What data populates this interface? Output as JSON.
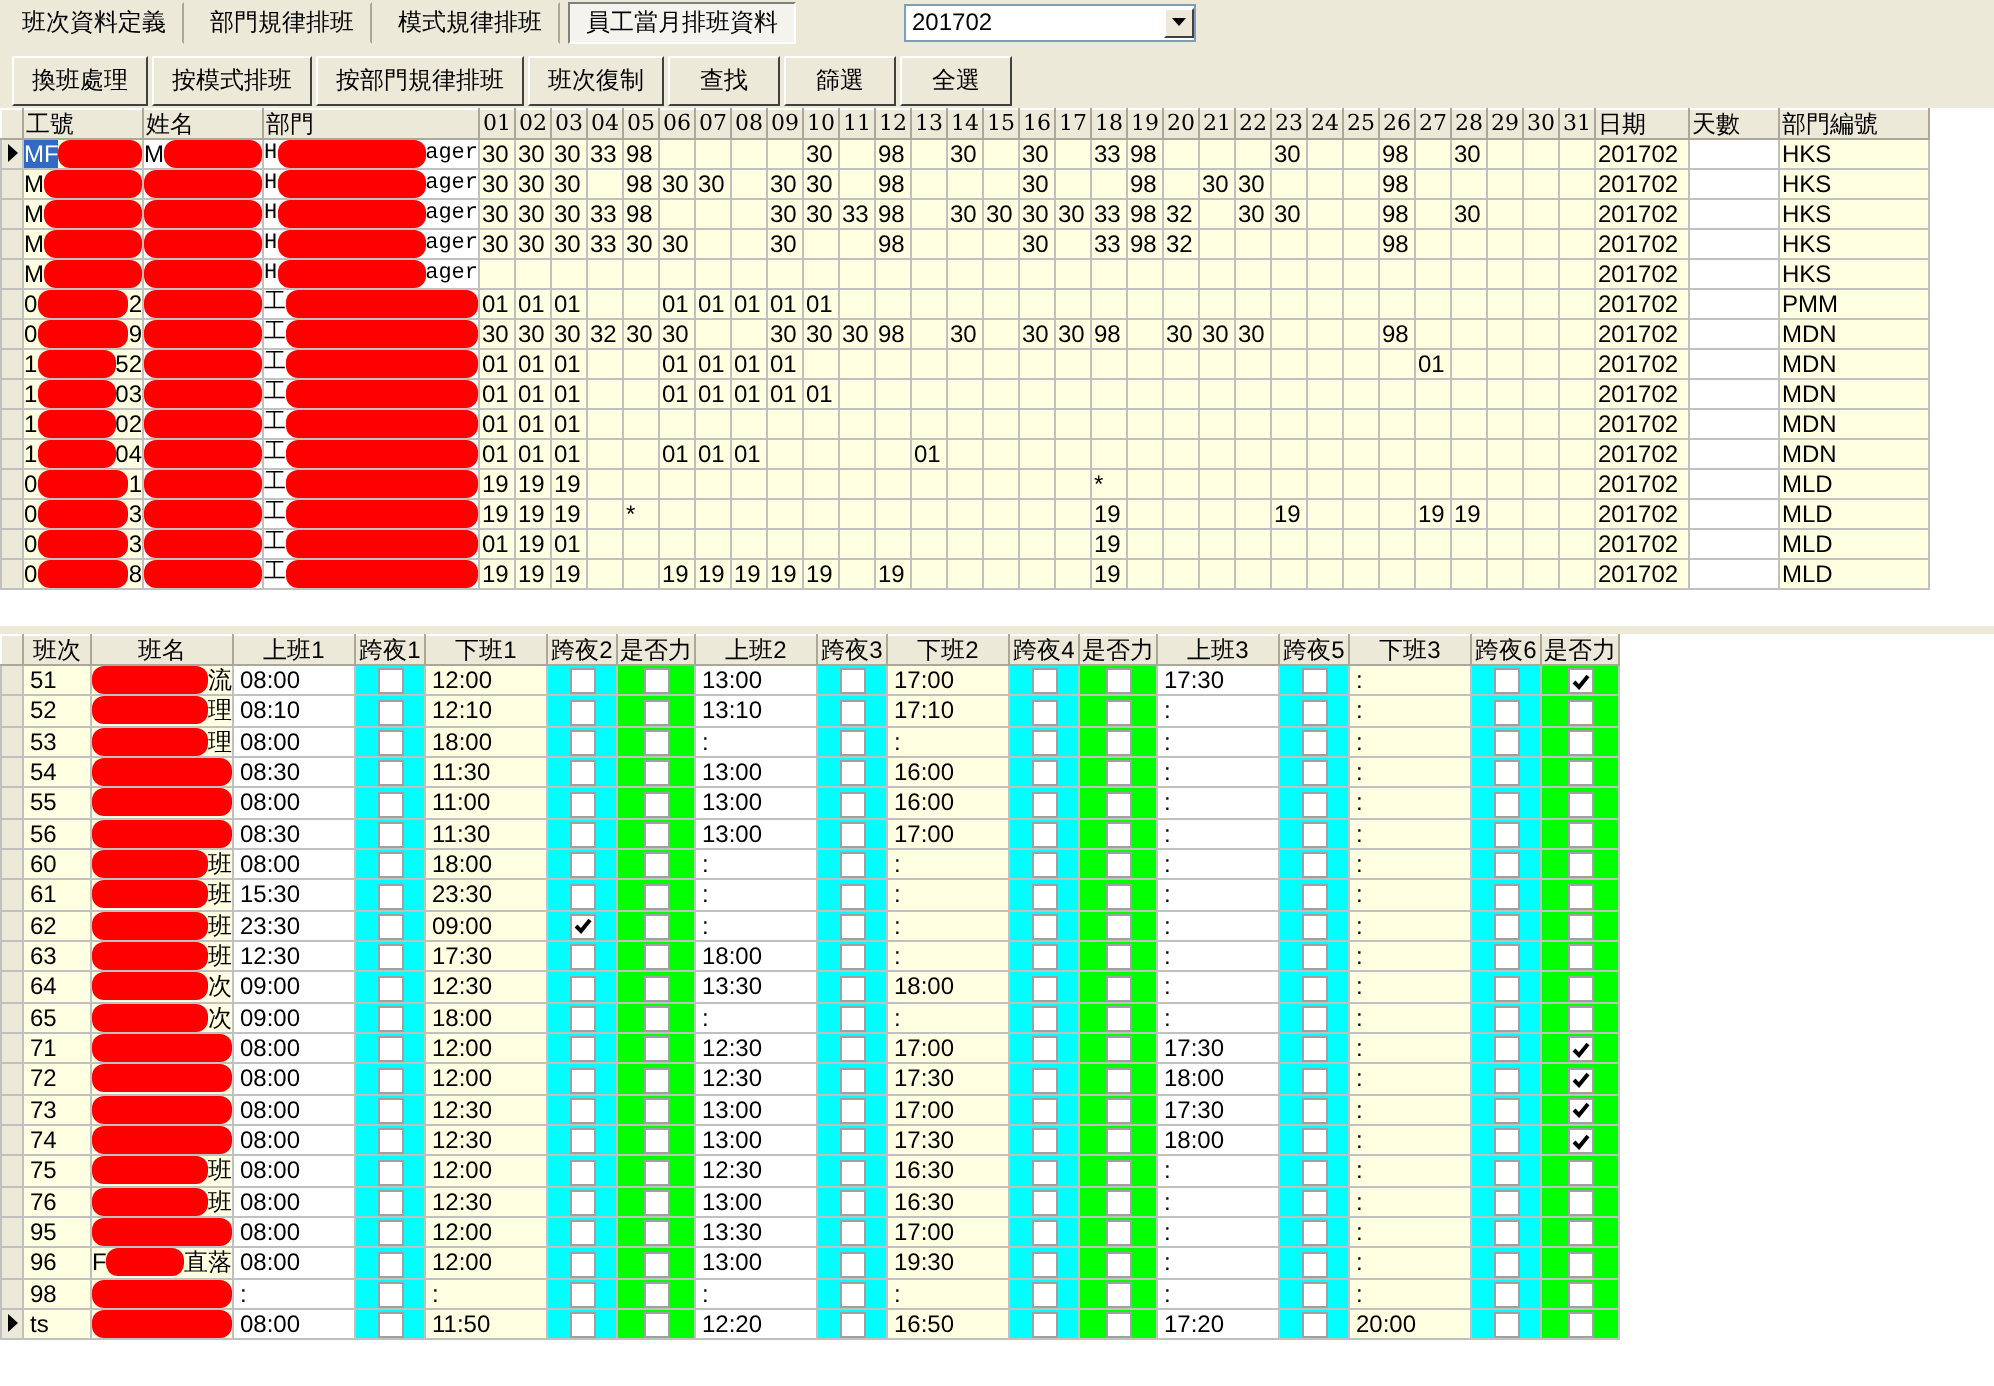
{
  "tabs": [
    {
      "label": "班次資料定義",
      "selected": false
    },
    {
      "label": "部門規律排班",
      "selected": false
    },
    {
      "label": "模式規律排班",
      "selected": false
    },
    {
      "label": "員工當月排班資料",
      "selected": true
    }
  ],
  "month_select": {
    "value": "201702"
  },
  "toolbar": [
    "換班處理",
    "按模式排班",
    "按部門規律排班",
    "班次復制",
    "查找",
    "篩選",
    "全選"
  ],
  "schedule_grid": {
    "columns": [
      "工號",
      "姓名",
      "部門"
    ],
    "day_columns": [
      "01",
      "02",
      "03",
      "04",
      "05",
      "06",
      "07",
      "08",
      "09",
      "10",
      "11",
      "12",
      "13",
      "14",
      "15",
      "16",
      "17",
      "18",
      "19",
      "20",
      "21",
      "22",
      "23",
      "24",
      "25",
      "26",
      "27",
      "28",
      "29",
      "30",
      "31"
    ],
    "tail_columns": [
      "日期",
      "天數",
      "部門編號"
    ],
    "rows": [
      {
        "current": true,
        "selected": true,
        "id": {
          "head": "MF"
        },
        "name": {
          "head": "M"
        },
        "dept": {
          "head": "H",
          "tail": "ager"
        },
        "days": {
          "d01": "30",
          "d02": "30",
          "d03": "30",
          "d04": "33",
          "d05": "98",
          "d10": "30",
          "d12": "98",
          "d14": "30",
          "d16": "30",
          "d18": "33",
          "d19": "98",
          "d23": "30",
          "d26": "98",
          "d28": "30"
        },
        "date": "201702",
        "dept_code": "HKS"
      },
      {
        "current": false,
        "selected": false,
        "id": {
          "head": "M"
        },
        "name": {},
        "dept": {
          "head": "H",
          "tail": "ager"
        },
        "days": {
          "d01": "30",
          "d02": "30",
          "d03": "30",
          "d05": "98",
          "d06": "30",
          "d07": "30",
          "d09": "30",
          "d10": "30",
          "d12": "98",
          "d16": "30",
          "d19": "98",
          "d21": "30",
          "d22": "30",
          "d26": "98"
        },
        "date": "201702",
        "dept_code": "HKS"
      },
      {
        "current": false,
        "selected": false,
        "id": {
          "head": "M"
        },
        "name": {},
        "dept": {
          "head": "H",
          "tail": "ager"
        },
        "days": {
          "d01": "30",
          "d02": "30",
          "d03": "30",
          "d04": "33",
          "d05": "98",
          "d09": "30",
          "d10": "30",
          "d11": "33",
          "d12": "98",
          "d14": "30",
          "d15": "30",
          "d16": "30",
          "d17": "30",
          "d18": "33",
          "d19": "98",
          "d20": "32",
          "d22": "30",
          "d23": "30",
          "d26": "98",
          "d28": "30"
        },
        "date": "201702",
        "dept_code": "HKS"
      },
      {
        "current": false,
        "selected": false,
        "id": {
          "head": "M"
        },
        "name": {},
        "dept": {
          "head": "H",
          "tail": "ager"
        },
        "days": {
          "d01": "30",
          "d02": "30",
          "d03": "30",
          "d04": "33",
          "d05": "30",
          "d06": "30",
          "d09": "30",
          "d12": "98",
          "d16": "30",
          "d18": "33",
          "d19": "98",
          "d20": "32",
          "d26": "98"
        },
        "date": "201702",
        "dept_code": "HKS"
      },
      {
        "current": false,
        "selected": false,
        "id": {
          "head": "M"
        },
        "name": {},
        "dept": {
          "head": "H",
          "tail": "ager"
        },
        "date": "201702",
        "dept_code": "HKS"
      },
      {
        "current": false,
        "selected": false,
        "id": {
          "head": "0",
          "tail": "2"
        },
        "name": {},
        "dept": {
          "head": "工"
        },
        "days": {
          "d01": "01",
          "d02": "01",
          "d03": "01",
          "d06": "01",
          "d07": "01",
          "d08": "01",
          "d09": "01",
          "d10": "01"
        },
        "date": "201702",
        "dept_code": "PMM"
      },
      {
        "current": false,
        "selected": false,
        "id": {
          "head": "0",
          "tail": "9"
        },
        "name": {},
        "dept": {
          "head": "工"
        },
        "days": {
          "d01": "30",
          "d02": "30",
          "d03": "30",
          "d04": "32",
          "d05": "30",
          "d06": "30",
          "d09": "30",
          "d10": "30",
          "d11": "30",
          "d12": "98",
          "d14": "30",
          "d16": "30",
          "d17": "30",
          "d18": "98",
          "d20": "30",
          "d21": "30",
          "d22": "30",
          "d26": "98"
        },
        "date": "201702",
        "dept_code": "MDN"
      },
      {
        "current": false,
        "selected": false,
        "id": {
          "head": "1",
          "tail": "52"
        },
        "name": {},
        "dept": {
          "head": "工"
        },
        "days": {
          "d01": "01",
          "d02": "01",
          "d03": "01",
          "d06": "01",
          "d07": "01",
          "d08": "01",
          "d09": "01",
          "d27": "01"
        },
        "date": "201702",
        "dept_code": "MDN"
      },
      {
        "current": false,
        "selected": false,
        "id": {
          "head": "1",
          "tail": "03"
        },
        "name": {},
        "dept": {
          "head": "工"
        },
        "days": {
          "d01": "01",
          "d02": "01",
          "d03": "01",
          "d06": "01",
          "d07": "01",
          "d08": "01",
          "d09": "01",
          "d10": "01"
        },
        "date": "201702",
        "dept_code": "MDN"
      },
      {
        "current": false,
        "selected": false,
        "id": {
          "head": "1",
          "tail": "02"
        },
        "name": {},
        "dept": {
          "head": "工"
        },
        "days": {
          "d01": "01",
          "d02": "01",
          "d03": "01"
        },
        "date": "201702",
        "dept_code": "MDN"
      },
      {
        "current": false,
        "selected": false,
        "id": {
          "head": "1",
          "tail": "04"
        },
        "name": {},
        "dept": {
          "head": "工"
        },
        "days": {
          "d01": "01",
          "d02": "01",
          "d03": "01",
          "d06": "01",
          "d07": "01",
          "d08": "01",
          "d13": "01"
        },
        "date": "201702",
        "dept_code": "MDN"
      },
      {
        "current": false,
        "selected": false,
        "id": {
          "head": "0",
          "tail": "1"
        },
        "name": {},
        "dept": {
          "head": "工"
        },
        "days": {
          "d01": "19",
          "d02": "19",
          "d03": "19",
          "d18": "*"
        },
        "date": "201702",
        "dept_code": "MLD"
      },
      {
        "current": false,
        "selected": false,
        "id": {
          "head": "0",
          "tail": "3"
        },
        "name": {},
        "dept": {
          "head": "工"
        },
        "days": {
          "d01": "19",
          "d02": "19",
          "d03": "19",
          "d05": "*",
          "d18": "19",
          "d23": "19",
          "d27": "19",
          "d28": "19"
        },
        "date": "201702",
        "dept_code": "MLD"
      },
      {
        "current": false,
        "selected": false,
        "id": {
          "head": "0",
          "tail": "3"
        },
        "name": {},
        "dept": {
          "head": "工"
        },
        "days": {
          "d01": "01",
          "d02": "19",
          "d03": "01",
          "d18": "19"
        },
        "date": "201702",
        "dept_code": "MLD"
      },
      {
        "current": false,
        "selected": false,
        "id": {
          "head": "0",
          "tail": "8"
        },
        "name": {},
        "dept": {
          "head": "工"
        },
        "days": {
          "d01": "19",
          "d02": "19",
          "d03": "19",
          "d06": "19",
          "d07": "19",
          "d08": "19",
          "d09": "19",
          "d10": "19",
          "d12": "19",
          "d18": "19"
        },
        "date": "201702",
        "dept_code": "MLD"
      }
    ]
  },
  "shift_grid": {
    "columns": [
      {
        "label": "班次",
        "kind": "code"
      },
      {
        "label": "班名",
        "kind": "name"
      },
      {
        "label": "上班1",
        "kind": "on"
      },
      {
        "label": "跨夜1",
        "kind": "night"
      },
      {
        "label": "下班1",
        "kind": "off"
      },
      {
        "label": "跨夜2",
        "kind": "night"
      },
      {
        "label": "是否力",
        "kind": "extra"
      },
      {
        "label": "上班2",
        "kind": "on"
      },
      {
        "label": "跨夜3",
        "kind": "night"
      },
      {
        "label": "下班2",
        "kind": "off"
      },
      {
        "label": "跨夜4",
        "kind": "night"
      },
      {
        "label": "是否力",
        "kind": "extra"
      },
      {
        "label": "上班3",
        "kind": "on"
      },
      {
        "label": "跨夜5",
        "kind": "night"
      },
      {
        "label": "下班3",
        "kind": "off"
      },
      {
        "label": "跨夜6",
        "kind": "night"
      },
      {
        "label": "是否力",
        "kind": "extra"
      }
    ],
    "rows": [
      {
        "current": false,
        "cells": [
          "51",
          {
            "tail": "流"
          },
          "08:00",
          false,
          "12:00",
          false,
          false,
          "13:00",
          false,
          "17:00",
          false,
          false,
          "17:30",
          false,
          ":",
          false,
          true
        ]
      },
      {
        "current": false,
        "cells": [
          "52",
          {
            "tail": "理"
          },
          "08:10",
          false,
          "12:10",
          false,
          false,
          "13:10",
          false,
          "17:10",
          false,
          false,
          ":",
          false,
          ":",
          false,
          false
        ]
      },
      {
        "current": false,
        "cells": [
          "53",
          {
            "tail": "理"
          },
          "08:00",
          false,
          "18:00",
          false,
          false,
          ":",
          false,
          ":",
          false,
          false,
          ":",
          false,
          ":",
          false,
          false
        ]
      },
      {
        "current": false,
        "cells": [
          "54",
          {},
          "08:30",
          false,
          "11:30",
          false,
          false,
          "13:00",
          false,
          "16:00",
          false,
          false,
          ":",
          false,
          ":",
          false,
          false
        ]
      },
      {
        "current": false,
        "cells": [
          "55",
          {},
          "08:00",
          false,
          "11:00",
          false,
          false,
          "13:00",
          false,
          "16:00",
          false,
          false,
          ":",
          false,
          ":",
          false,
          false
        ]
      },
      {
        "current": false,
        "cells": [
          "56",
          {},
          "08:30",
          false,
          "11:30",
          false,
          false,
          "13:00",
          false,
          "17:00",
          false,
          false,
          ":",
          false,
          ":",
          false,
          false
        ]
      },
      {
        "current": false,
        "cells": [
          "60",
          {
            "tail": "班"
          },
          "08:00",
          false,
          "18:00",
          false,
          false,
          ":",
          false,
          ":",
          false,
          false,
          ":",
          false,
          ":",
          false,
          false
        ]
      },
      {
        "current": false,
        "cells": [
          "61",
          {
            "tail": "班"
          },
          "15:30",
          false,
          "23:30",
          false,
          false,
          ":",
          false,
          ":",
          false,
          false,
          ":",
          false,
          ":",
          false,
          false
        ]
      },
      {
        "current": false,
        "cells": [
          "62",
          {
            "tail": "班"
          },
          "23:30",
          false,
          "09:00",
          true,
          false,
          ":",
          false,
          ":",
          false,
          false,
          ":",
          false,
          ":",
          false,
          false
        ]
      },
      {
        "current": false,
        "cells": [
          "63",
          {
            "tail": "班"
          },
          "12:30",
          false,
          "17:30",
          false,
          false,
          "18:00",
          false,
          ":",
          false,
          false,
          ":",
          false,
          ":",
          false,
          false
        ]
      },
      {
        "current": false,
        "cells": [
          "64",
          {
            "tail": "次"
          },
          "09:00",
          false,
          "12:30",
          false,
          false,
          "13:30",
          false,
          "18:00",
          false,
          false,
          ":",
          false,
          ":",
          false,
          false
        ]
      },
      {
        "current": false,
        "cells": [
          "65",
          {
            "tail": "次"
          },
          "09:00",
          false,
          "18:00",
          false,
          false,
          ":",
          false,
          ":",
          false,
          false,
          ":",
          false,
          ":",
          false,
          false
        ]
      },
      {
        "current": false,
        "cells": [
          "71",
          {},
          "08:00",
          false,
          "12:00",
          false,
          false,
          "12:30",
          false,
          "17:00",
          false,
          false,
          "17:30",
          false,
          ":",
          false,
          true
        ]
      },
      {
        "current": false,
        "cells": [
          "72",
          {},
          "08:00",
          false,
          "12:00",
          false,
          false,
          "12:30",
          false,
          "17:30",
          false,
          false,
          "18:00",
          false,
          ":",
          false,
          true
        ]
      },
      {
        "current": false,
        "cells": [
          "73",
          {},
          "08:00",
          false,
          "12:30",
          false,
          false,
          "13:00",
          false,
          "17:00",
          false,
          false,
          "17:30",
          false,
          ":",
          false,
          true
        ]
      },
      {
        "current": false,
        "cells": [
          "74",
          {},
          "08:00",
          false,
          "12:30",
          false,
          false,
          "13:00",
          false,
          "17:30",
          false,
          false,
          "18:00",
          false,
          ":",
          false,
          true
        ]
      },
      {
        "current": false,
        "cells": [
          "75",
          {
            "tail": "班"
          },
          "08:00",
          false,
          "12:00",
          false,
          false,
          "12:30",
          false,
          "16:30",
          false,
          false,
          ":",
          false,
          ":",
          false,
          false
        ]
      },
      {
        "current": false,
        "cells": [
          "76",
          {
            "tail": "班"
          },
          "08:00",
          false,
          "12:30",
          false,
          false,
          "13:00",
          false,
          "16:30",
          false,
          false,
          ":",
          false,
          ":",
          false,
          false
        ]
      },
      {
        "current": false,
        "cells": [
          "95",
          {},
          "08:00",
          false,
          "12:00",
          false,
          false,
          "13:30",
          false,
          "17:00",
          false,
          false,
          ":",
          false,
          ":",
          false,
          false
        ]
      },
      {
        "current": false,
        "cells": [
          "96",
          {
            "head": "F",
            "tail": "直落"
          },
          "08:00",
          false,
          "12:00",
          false,
          false,
          "13:00",
          false,
          "19:30",
          false,
          false,
          ":",
          false,
          ":",
          false,
          false
        ]
      },
      {
        "current": false,
        "cells": [
          "98",
          {},
          ":",
          false,
          ":",
          false,
          false,
          ":",
          false,
          ":",
          false,
          false,
          ":",
          false,
          ":",
          false,
          false
        ]
      },
      {
        "current": true,
        "cells": [
          "ts",
          {},
          "08:00",
          false,
          "11:50",
          false,
          false,
          "12:20",
          false,
          "16:50",
          false,
          false,
          "17:20",
          false,
          "20:00",
          false,
          false
        ]
      }
    ]
  }
}
